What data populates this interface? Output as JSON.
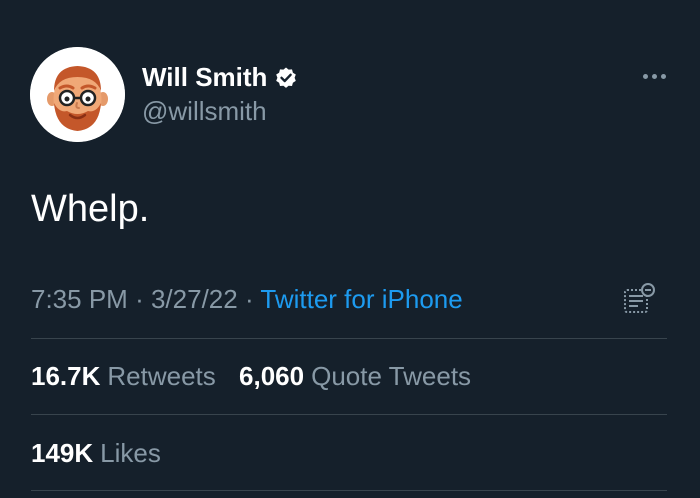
{
  "author": {
    "name": "Will Smith",
    "handle": "@willsmith",
    "verified": true,
    "avatar_icon": "bearded-face-with-glasses-avatar"
  },
  "tweet": {
    "text": "Whelp."
  },
  "meta": {
    "time": "7:35 PM",
    "sep1": "·",
    "date": "3/27/22",
    "sep2": "·",
    "source": "Twitter for iPhone"
  },
  "stats": {
    "retweets": {
      "count": "16.7K",
      "label": "Retweets"
    },
    "quote_tweets": {
      "count": "6,060",
      "label": "Quote Tweets"
    },
    "likes": {
      "count": "149K",
      "label": "Likes"
    }
  },
  "icons": {
    "more": "more-options-icon",
    "analytics": "tweet-analytics-icon",
    "verified": "verified-badge-icon"
  },
  "colors": {
    "background": "#15202b",
    "text_primary": "#ffffff",
    "text_secondary": "#8899a6",
    "link": "#1d9bf0",
    "divider": "#38444d"
  }
}
